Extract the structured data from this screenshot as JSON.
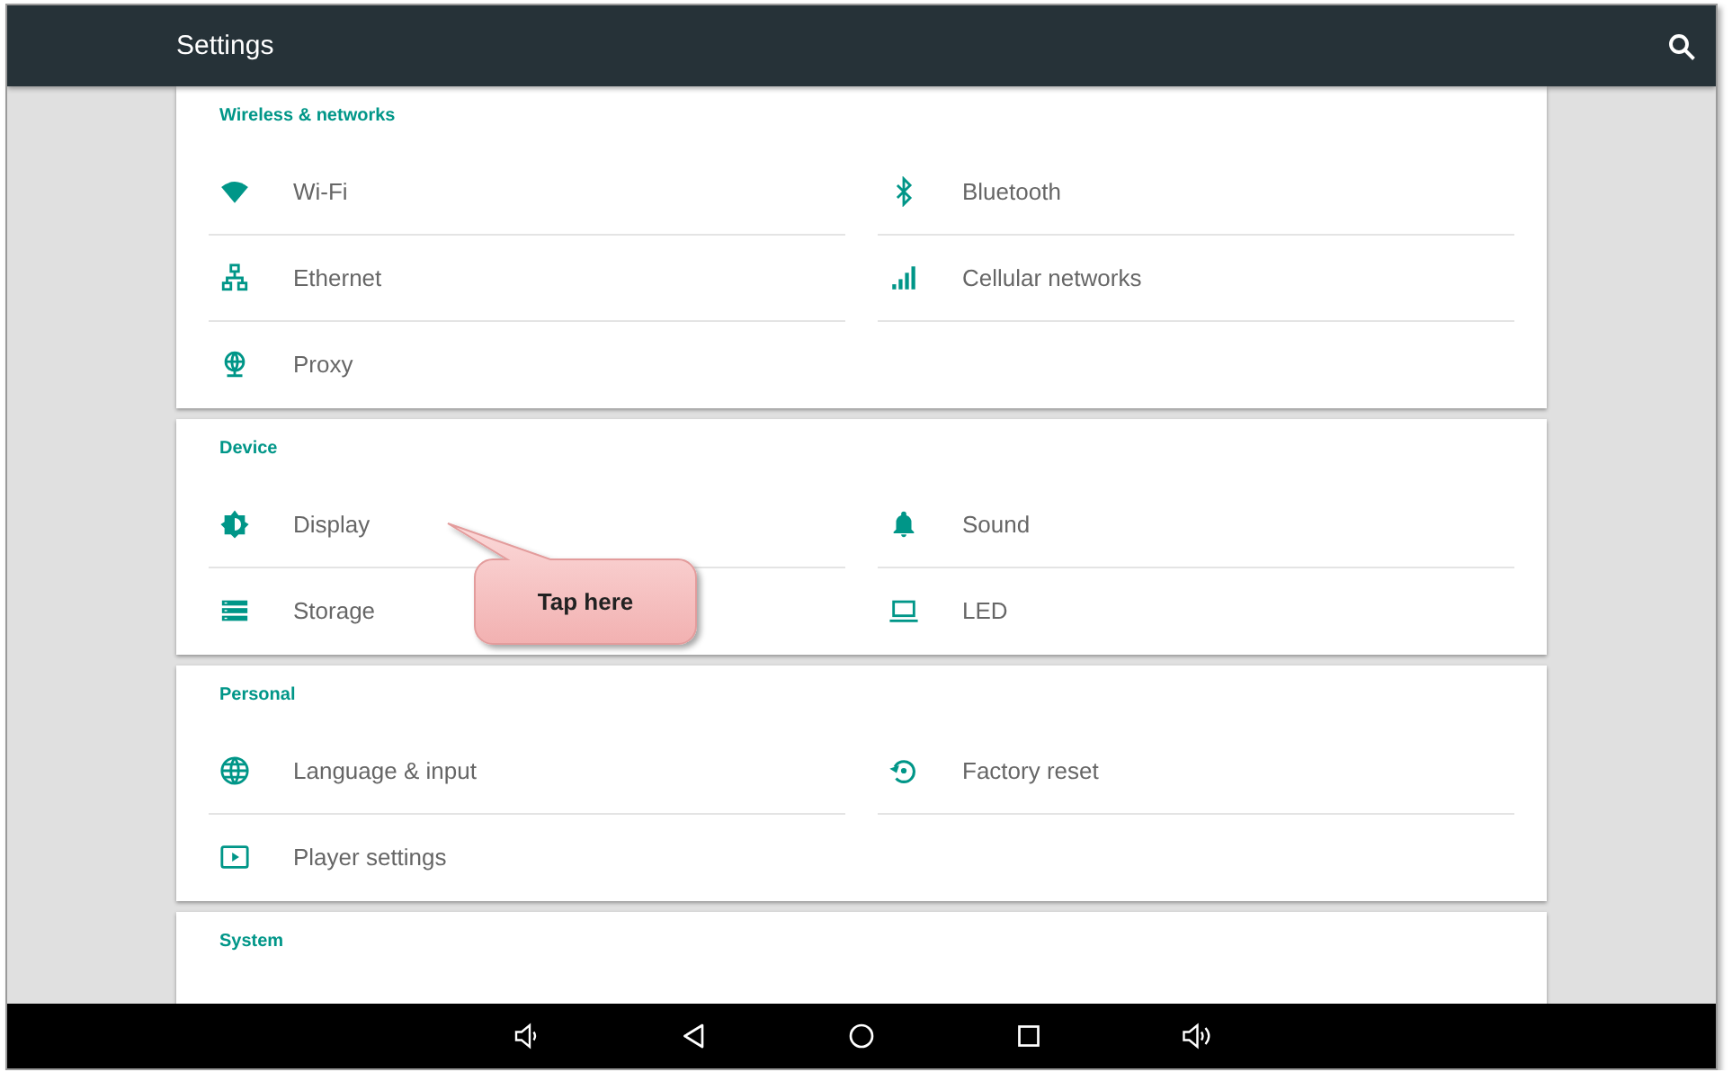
{
  "app_bar": {
    "title": "Settings"
  },
  "sections": [
    {
      "heading": "Wireless & networks",
      "items": [
        {
          "kind": "wifi",
          "label": "Wi-Fi"
        },
        {
          "kind": "bluetooth",
          "label": "Bluetooth"
        },
        {
          "kind": "ethernet",
          "label": "Ethernet"
        },
        {
          "kind": "cellular",
          "label": "Cellular networks"
        },
        {
          "kind": "proxy",
          "label": "Proxy"
        }
      ]
    },
    {
      "heading": "Device",
      "items": [
        {
          "kind": "display",
          "label": "Display"
        },
        {
          "kind": "sound",
          "label": "Sound"
        },
        {
          "kind": "storage",
          "label": "Storage"
        },
        {
          "kind": "led",
          "label": "LED"
        }
      ]
    },
    {
      "heading": "Personal",
      "items": [
        {
          "kind": "language",
          "label": "Language & input"
        },
        {
          "kind": "factory_reset",
          "label": "Factory reset"
        },
        {
          "kind": "player",
          "label": "Player settings"
        }
      ]
    },
    {
      "heading": "System"
    }
  ],
  "callout": {
    "text": "Tap here"
  },
  "nav_bar": [
    {
      "kind": "volume_down"
    },
    {
      "kind": "back"
    },
    {
      "kind": "home"
    },
    {
      "kind": "recents"
    },
    {
      "kind": "volume_up"
    }
  ]
}
